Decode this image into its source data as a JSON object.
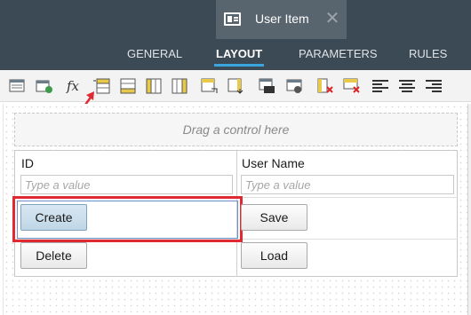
{
  "window": {
    "title": "User Item",
    "close_glyph": "✕",
    "icon": "form-icon"
  },
  "tabs": [
    {
      "label": "GENERAL",
      "active": false
    },
    {
      "label": "LAYOUT",
      "active": true
    },
    {
      "label": "PARAMETERS",
      "active": false
    },
    {
      "label": "RULES",
      "active": false
    }
  ],
  "toolbar": {
    "fx_label": "fx",
    "tools": [
      "form-grid-icon",
      "edit-form-icon",
      "expression-icon",
      "insert-row-above-icon",
      "insert-row-below-icon",
      "insert-column-left-icon",
      "insert-column-right-icon",
      "merge-cells-icon",
      "split-cells-icon",
      "cell-properties-icon",
      "table-properties-icon",
      "delete-column-icon",
      "delete-row-icon",
      "align-left-icon",
      "align-center-icon",
      "align-right-icon"
    ]
  },
  "canvas": {
    "dropzone_text": "Drag a control here",
    "columns": [
      "ID",
      "User Name"
    ],
    "inputs": [
      {
        "placeholder": "Type a value"
      },
      {
        "placeholder": "Type a value"
      }
    ],
    "buttons": {
      "create": "Create",
      "save": "Save",
      "delete": "Delete",
      "load": "Load"
    }
  },
  "colors": {
    "titlebar": "#3c4a55",
    "active_tab_underline": "#3aa6e0",
    "annotation": "#e02a33",
    "selected_button": "#c9dcea"
  }
}
